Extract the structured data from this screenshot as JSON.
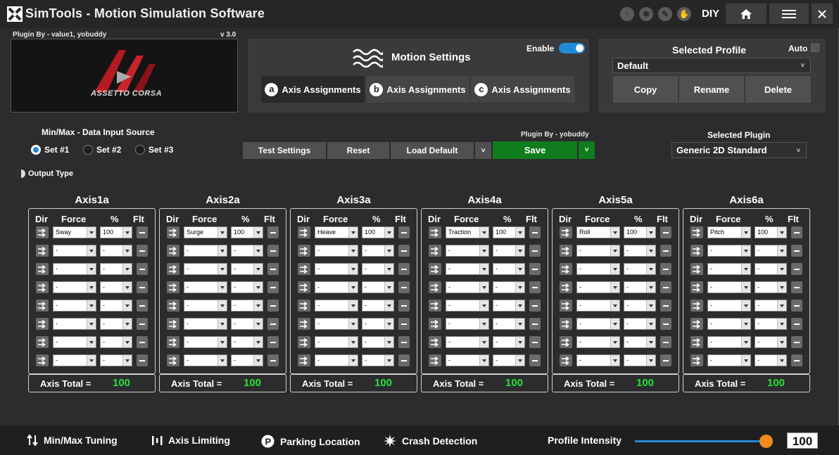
{
  "app": {
    "title": "SimTools - Motion Simulation Software",
    "mode": "DIY"
  },
  "plugin": {
    "credit": "Plugin By - value1, yobuddy",
    "version": "v 3.0",
    "logo_text": "ASSETTO CORSA"
  },
  "motion": {
    "title": "Motion Settings",
    "enable_label": "Enable",
    "enabled": true,
    "tabs": [
      {
        "letter": "a",
        "label": "Axis Assignments",
        "active": true
      },
      {
        "letter": "b",
        "label": "Axis Assignments",
        "active": false
      },
      {
        "letter": "c",
        "label": "Axis Assignments",
        "active": false
      }
    ]
  },
  "profile": {
    "title": "Selected Profile",
    "auto_label": "Auto",
    "selected": "Default",
    "buttons": {
      "copy": "Copy",
      "rename": "Rename",
      "delete": "Delete"
    }
  },
  "input_source": {
    "title": "Min/Max - Data Input Source",
    "options": [
      "Set #1",
      "Set #2",
      "Set #3"
    ],
    "selected_index": 0
  },
  "toolbar": {
    "test": "Test Settings",
    "reset": "Reset",
    "load_default": "Load Default",
    "save": "Save",
    "plugin_credit": "Plugin By - yobuddy"
  },
  "selected_plugin": {
    "title": "Selected Plugin",
    "value": "Generic 2D Standard"
  },
  "output_type_label": "Output Type",
  "axis_headers": {
    "dir": "Dir",
    "force": "Force",
    "pct": "%",
    "flt": "Flt",
    "total_label": "Axis Total ="
  },
  "axes": [
    {
      "name": "Axis1a",
      "force": "Sway",
      "pct": "100",
      "total": "100"
    },
    {
      "name": "Axis2a",
      "force": "Surge",
      "pct": "100",
      "total": "100"
    },
    {
      "name": "Axis3a",
      "force": "Heave",
      "pct": "100",
      "total": "100"
    },
    {
      "name": "Axis4a",
      "force": "Traction",
      "pct": "100",
      "total": "100"
    },
    {
      "name": "Axis5a",
      "force": "Roll",
      "pct": "100",
      "total": "100"
    },
    {
      "name": "Axis6a",
      "force": "Pitch",
      "pct": "100",
      "total": "100"
    }
  ],
  "empty_value": "-",
  "bottom": {
    "minmax": "Min/Max Tuning",
    "limiting": "Axis Limiting",
    "parking": "Parking Location",
    "crash": "Crash Detection",
    "intensity_label": "Profile Intensity",
    "intensity_value": "100",
    "intensity_fraction": 1.0
  },
  "colors": {
    "accent_blue": "#1f8ad9",
    "save_green": "#0f7d1e",
    "total_green": "#27e23a",
    "slider_orange": "#f08a1c"
  }
}
